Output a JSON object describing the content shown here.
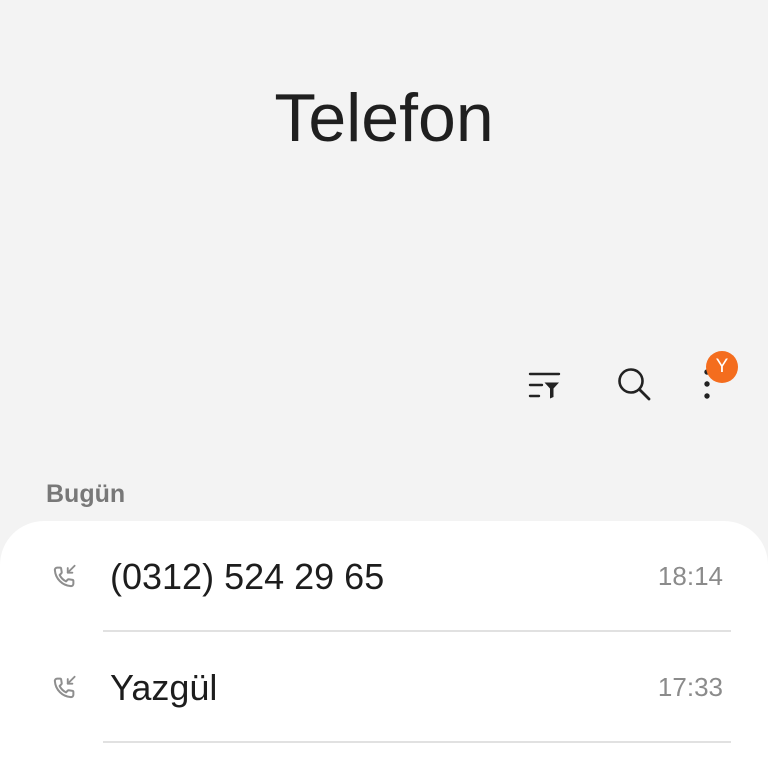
{
  "app": {
    "title": "Telefon"
  },
  "toolbar": {
    "filter_icon": "filter-icon",
    "search_icon": "search-icon",
    "more_icon": "more-vertical-icon",
    "badge_text": "Y",
    "badge_color": "#f46d1e",
    "icon_color": "#222222"
  },
  "section": {
    "label": "Bugün"
  },
  "calls": [
    {
      "name": "(0312) 524 29 65",
      "time": "18:14",
      "type_icon": "incoming-call-icon"
    },
    {
      "name": "Yazgül",
      "time": "17:33",
      "type_icon": "incoming-call-icon"
    }
  ],
  "colors": {
    "background": "#f3f3f3",
    "card": "#ffffff",
    "secondary_text": "#8b8b8b"
  }
}
